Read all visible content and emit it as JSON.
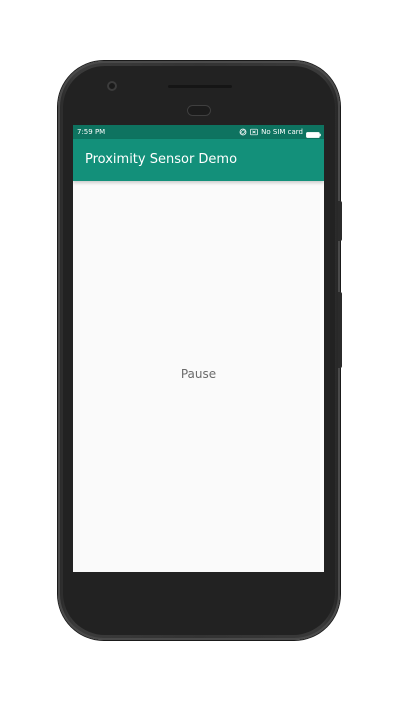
{
  "status_bar": {
    "time": "7:59 PM",
    "carrier": "No SIM card",
    "icons": [
      "rotation-lock-icon",
      "sim-card-icon",
      "battery-icon"
    ]
  },
  "app_bar": {
    "title": "Proximity Sensor Demo",
    "color": "#13907a"
  },
  "content": {
    "status_text": "Pause"
  },
  "colors": {
    "status_bar": "#0e7360",
    "app_bar": "#13907a",
    "screen_background": "#fafafa",
    "device_frame": "#333333"
  }
}
